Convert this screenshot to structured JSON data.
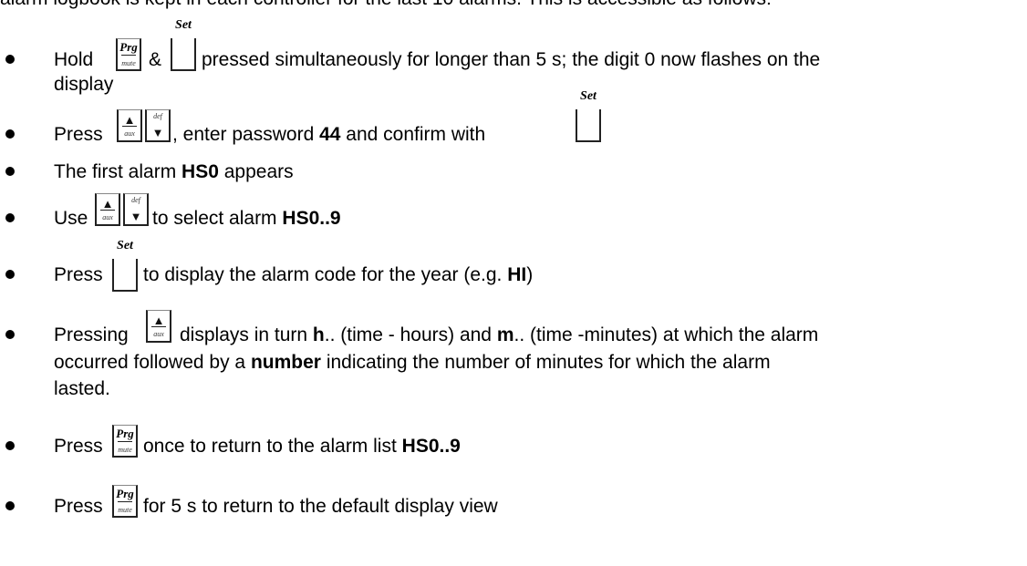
{
  "intro": "alarm logbook is kept in each controller for the last 10 alarms. This is accessible as follows:",
  "keys": {
    "prg": {
      "top": "Prg",
      "bottom": "mute"
    },
    "set": {
      "label": "Set"
    },
    "up": {
      "arrow": "▲",
      "sub": "aux"
    },
    "down": {
      "sup": "def",
      "arrow": "▼"
    }
  },
  "steps": [
    {
      "a": "Hold",
      "b": "&",
      "c": "pressed simultaneously for longer than 5 s; the digit 0 now flashes on the",
      "d": "display"
    },
    {
      "a": "Press",
      "b": ", enter password",
      "b_bold": "44",
      "c": "and confirm with"
    },
    {
      "a": "The first alarm",
      "a_bold": "HS0",
      "b": "appears"
    },
    {
      "a": "Use",
      "b": "to select alarm",
      "b_bold": "HS0..9"
    },
    {
      "a": "Press",
      "b": "to display the alarm code for the year (e.g.",
      "b_bold": "HI",
      "c": ")"
    },
    {
      "a": "Pressing",
      "b": "displays in turn",
      "b_bold": "h",
      "c": ".. (time - hours) and",
      "c_bold": "m",
      "d": ".. (time -minutes) at which the alarm",
      "e": "occurred followed by a",
      "e_bold": "number",
      "f": "indicating the number of minutes for which the alarm",
      "g": "lasted."
    },
    {
      "a": "Press",
      "b": "once to return to the alarm list",
      "b_bold": "HS0..9"
    },
    {
      "a": "Press",
      "b": "for 5 s to return to the default display view"
    }
  ]
}
